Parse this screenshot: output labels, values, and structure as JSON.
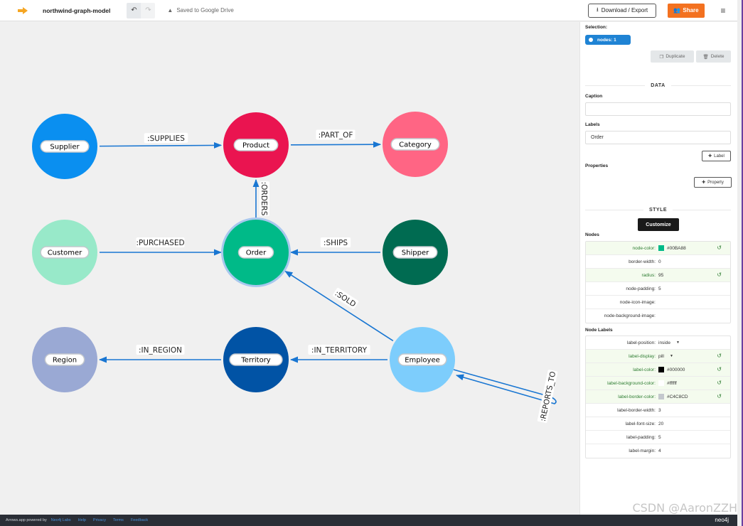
{
  "header": {
    "title": "northwind-graph-model",
    "undo_icon": "undo-icon",
    "redo_icon": "redo-icon",
    "saved_status": "Saved to Google Drive",
    "download_label": "Download / Export",
    "share_label": "Share",
    "menu_icon": "hamburger-icon"
  },
  "graph": {
    "nodes": [
      {
        "id": "supplier",
        "label": "Supplier",
        "color": "#0a8ff0"
      },
      {
        "id": "product",
        "label": "Product",
        "color": "#ea1450"
      },
      {
        "id": "category",
        "label": "Category",
        "color": "#ff6584"
      },
      {
        "id": "customer",
        "label": "Customer",
        "color": "#98e9c9"
      },
      {
        "id": "order",
        "label": "Order",
        "color": "#00ba88",
        "selected": true
      },
      {
        "id": "shipper",
        "label": "Shipper",
        "color": "#006b51"
      },
      {
        "id": "region",
        "label": "Region",
        "color": "#9aa9d4"
      },
      {
        "id": "territory",
        "label": "Territory",
        "color": "#0153a5"
      },
      {
        "id": "employee",
        "label": "Employee",
        "color": "#7dcdfc"
      }
    ],
    "relationships": [
      {
        "from": "supplier",
        "to": "product",
        "type": ":SUPPLIES"
      },
      {
        "from": "product",
        "to": "category",
        "type": ":PART_OF"
      },
      {
        "from": "order",
        "to": "product",
        "type": ":ORDERS"
      },
      {
        "from": "customer",
        "to": "order",
        "type": ":PURCHASED"
      },
      {
        "from": "shipper",
        "to": "order",
        "type": ":SHIPS"
      },
      {
        "from": "employee",
        "to": "order",
        "type": ":SOLD"
      },
      {
        "from": "territory",
        "to": "region",
        "type": ":IN_REGION"
      },
      {
        "from": "employee",
        "to": "territory",
        "type": ":IN_TERRITORY"
      },
      {
        "from": "employee",
        "to": "employee",
        "type": ":REPORTS_TO"
      }
    ],
    "edge_color": "#1976d2"
  },
  "panel": {
    "selection_title": "Selection:",
    "selection_pill": "nodes:  1",
    "duplicate_label": "Duplicate",
    "delete_label": "Delete",
    "data_title": "DATA",
    "caption_label": "Caption",
    "caption_value": "",
    "labels_label": "Labels",
    "labels_value": "Order",
    "add_label_btn": "Label",
    "properties_label": "Properties",
    "add_property_btn": "Property",
    "style_title": "STYLE",
    "customize_label": "Customize",
    "nodes_title": "Nodes",
    "node_props": [
      {
        "key": "node-color:",
        "value": "#00BA88",
        "swatch": "#00BA88",
        "modified": true
      },
      {
        "key": "border-width:",
        "value": "0",
        "modified": false
      },
      {
        "key": "radius:",
        "value": "95",
        "modified": true
      },
      {
        "key": "node-padding:",
        "value": "5",
        "modified": false
      },
      {
        "key": "node-icon-image:",
        "value": "",
        "modified": false
      },
      {
        "key": "node-background-image:",
        "value": "",
        "modified": false
      }
    ],
    "node_labels_title": "Node Labels",
    "label_props": [
      {
        "key": "label-position:",
        "value": "inside",
        "dropdown": true,
        "modified": false
      },
      {
        "key": "label-display:",
        "value": "pill",
        "dropdown": true,
        "modified": true
      },
      {
        "key": "label-color:",
        "value": "#000000",
        "swatch": "#000000",
        "modified": true
      },
      {
        "key": "label-background-color:",
        "value": "#ffffff",
        "swatch": "#ffffff",
        "modified": true
      },
      {
        "key": "label-border-color:",
        "value": "#C4C8CD",
        "swatch": "#C4C8CD",
        "modified": true
      },
      {
        "key": "label-border-width:",
        "value": "3",
        "modified": false
      },
      {
        "key": "label-font-size:",
        "value": "20",
        "modified": false
      },
      {
        "key": "label-padding:",
        "value": "5",
        "modified": false
      },
      {
        "key": "label-margin:",
        "value": "4",
        "modified": false
      }
    ]
  },
  "footer": {
    "powered_by": "Arrows.app powered by",
    "neo4j_labs": "Neo4j Labs",
    "help": "Help",
    "privacy": "Privacy",
    "terms": "Terms",
    "feedback": "Feedback",
    "logo": "neo4j"
  },
  "watermark": "CSDN @AaronZZH"
}
